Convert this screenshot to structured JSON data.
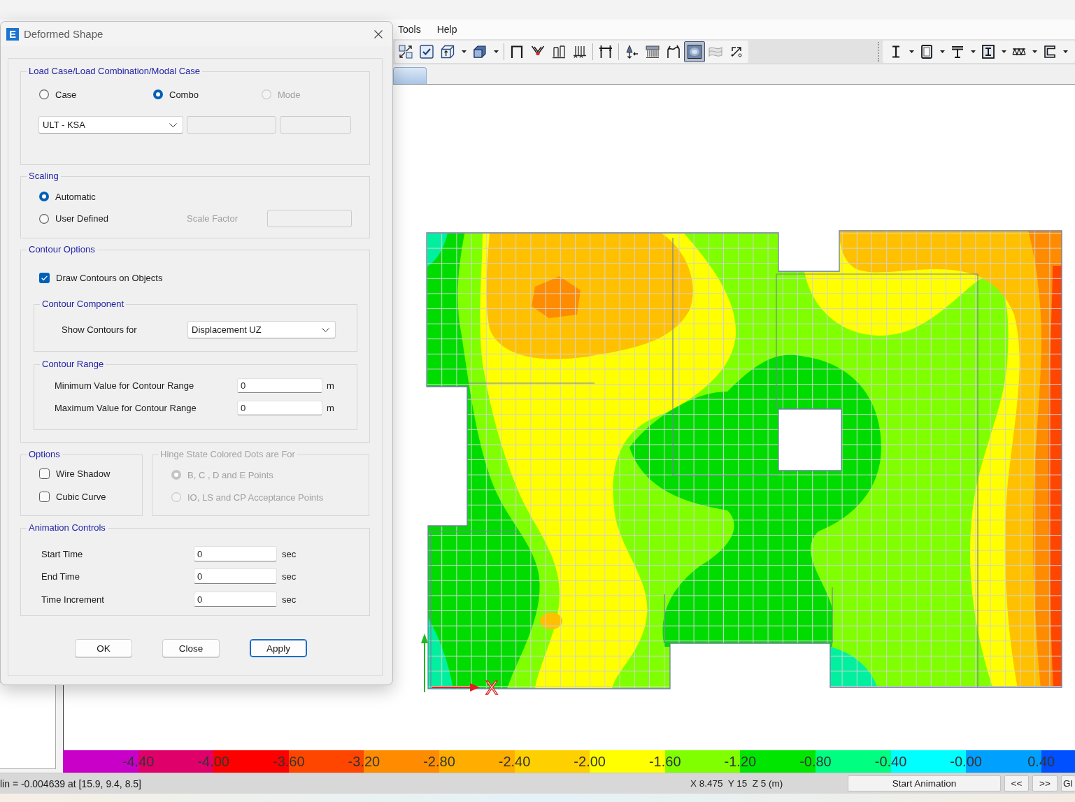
{
  "menu": [
    {
      "label": "Tools"
    },
    {
      "label": "Help"
    }
  ],
  "toolbar": {
    "groups": [
      {
        "buttons": [
          {
            "kind": "button",
            "pressed": false,
            "disabled": false,
            "dropdown": false
          },
          {
            "kind": "button",
            "pressed": false,
            "disabled": false,
            "dropdown": false
          },
          {
            "kind": "button",
            "pressed": false,
            "disabled": false,
            "dropdown": true
          },
          {
            "kind": "button",
            "pressed": false,
            "disabled": false,
            "dropdown": true
          },
          {
            "kind": "separator"
          },
          {
            "kind": "button",
            "pressed": false,
            "disabled": false,
            "dropdown": false
          },
          {
            "kind": "button",
            "pressed": false,
            "disabled": false,
            "dropdown": false
          },
          {
            "kind": "button",
            "pressed": false,
            "disabled": false,
            "dropdown": false
          },
          {
            "kind": "button",
            "pressed": false,
            "disabled": false,
            "dropdown": false
          },
          {
            "kind": "separator"
          },
          {
            "kind": "button",
            "pressed": false,
            "disabled": false,
            "dropdown": false
          },
          {
            "kind": "separator"
          },
          {
            "kind": "button",
            "pressed": false,
            "disabled": false,
            "dropdown": false
          },
          {
            "kind": "button",
            "pressed": false,
            "disabled": false,
            "dropdown": false
          },
          {
            "kind": "button",
            "pressed": false,
            "disabled": false,
            "dropdown": false
          },
          {
            "kind": "button",
            "pressed": true,
            "disabled": false,
            "dropdown": false
          },
          {
            "kind": "button",
            "pressed": false,
            "disabled": true,
            "dropdown": false
          },
          {
            "kind": "button",
            "pressed": false,
            "disabled": false,
            "dropdown": false
          }
        ]
      },
      {
        "buttons": [
          {
            "kind": "button",
            "pressed": false,
            "disabled": false,
            "dropdown": true
          },
          {
            "kind": "button",
            "pressed": false,
            "disabled": false,
            "dropdown": true
          },
          {
            "kind": "button",
            "pressed": false,
            "disabled": false,
            "dropdown": true
          },
          {
            "kind": "button",
            "pressed": false,
            "disabled": false,
            "dropdown": true
          },
          {
            "kind": "button",
            "pressed": false,
            "disabled": false,
            "dropdown": true
          },
          {
            "kind": "button",
            "pressed": false,
            "disabled": false,
            "dropdown": true
          }
        ]
      }
    ]
  },
  "canvas": {
    "axis_label": "X"
  },
  "legend": {
    "segments": [
      {
        "color": "#c800c8"
      },
      {
        "color": "#e0006a",
        "label": "-4.40"
      },
      {
        "color": "#ff0000",
        "label": "-4.00"
      },
      {
        "color": "#ff4600",
        "label": "-3.60"
      },
      {
        "color": "#ff8c00",
        "label": "-3.20"
      },
      {
        "color": "#ffae00",
        "label": "-2.80"
      },
      {
        "color": "#ffd000",
        "label": "-2.40"
      },
      {
        "color": "#ffff00",
        "label": "-2.00"
      },
      {
        "color": "#80ff00",
        "label": "-1.60"
      },
      {
        "color": "#00e600",
        "label": "-1.20"
      },
      {
        "color": "#00ff80",
        "label": "-0.80"
      },
      {
        "color": "#00ffff",
        "label": "-0.40"
      },
      {
        "color": "#00a0ff",
        "label": "-0.00"
      },
      {
        "color": "#0050ff",
        "label": "0.40"
      }
    ]
  },
  "status_bar": {
    "message": "lin = -0.004639 at [15.9, 9.4, 8.5]",
    "coordinates": "X 8.475  Y 15  Z 5 (m)",
    "buttons": [
      "Start Animation",
      "<<",
      ">>",
      "Gl"
    ]
  },
  "dialog": {
    "icon_text": "E",
    "title": "Deformed Shape",
    "load_case": {
      "legend": "Load Case/Load Combination/Modal Case",
      "options": [
        {
          "label": "Case",
          "selected": false,
          "disabled": false
        },
        {
          "label": "Combo",
          "selected": true,
          "disabled": false
        },
        {
          "label": "Mode",
          "selected": false,
          "disabled": true
        }
      ],
      "dropdown": {
        "value": "ULT - KSA"
      },
      "fields": [
        {
          "disabled": true
        },
        {
          "disabled": true
        }
      ]
    },
    "scaling": {
      "legend": "Scaling",
      "options": [
        {
          "label": "Automatic",
          "selected": true
        },
        {
          "label": "User Defined",
          "selected": false
        }
      ],
      "scale_factor": {
        "label": "Scale Factor",
        "disabled": true
      }
    },
    "contour_options": {
      "legend": "Contour Options",
      "draw_contours": {
        "label": "Draw Contours on Objects",
        "checked": true
      },
      "component": {
        "legend": "Contour Component",
        "label": "Show Contours for",
        "value": "Displacement UZ"
      },
      "range": {
        "legend": "Contour Range",
        "fields": [
          {
            "label": "Minimum Value for Contour Range",
            "value": "0",
            "unit": "m"
          },
          {
            "label": "Maximum Value for Contour Range",
            "value": "0",
            "unit": "m"
          }
        ]
      }
    },
    "options": {
      "legend": "Options",
      "items": [
        {
          "label": "Wire Shadow",
          "checked": false
        },
        {
          "label": "Cubic Curve",
          "checked": false
        }
      ]
    },
    "hinge_dots": {
      "legend": "Hinge State Colored Dots are For",
      "disabled": true,
      "options": [
        {
          "label": "B, C , D and E Points",
          "selected": true
        },
        {
          "label": "IO, LS and CP Acceptance Points",
          "selected": false
        }
      ]
    },
    "animation": {
      "legend": "Animation Controls",
      "fields": [
        {
          "label": "Start Time",
          "value": "0",
          "unit": "sec"
        },
        {
          "label": "End Time",
          "value": "0",
          "unit": "sec"
        },
        {
          "label": "Time Increment",
          "value": "0",
          "unit": "sec"
        }
      ]
    },
    "buttons": [
      {
        "label": "OK",
        "default": false
      },
      {
        "label": "Close",
        "default": false
      },
      {
        "label": "Apply",
        "default": true
      }
    ]
  }
}
